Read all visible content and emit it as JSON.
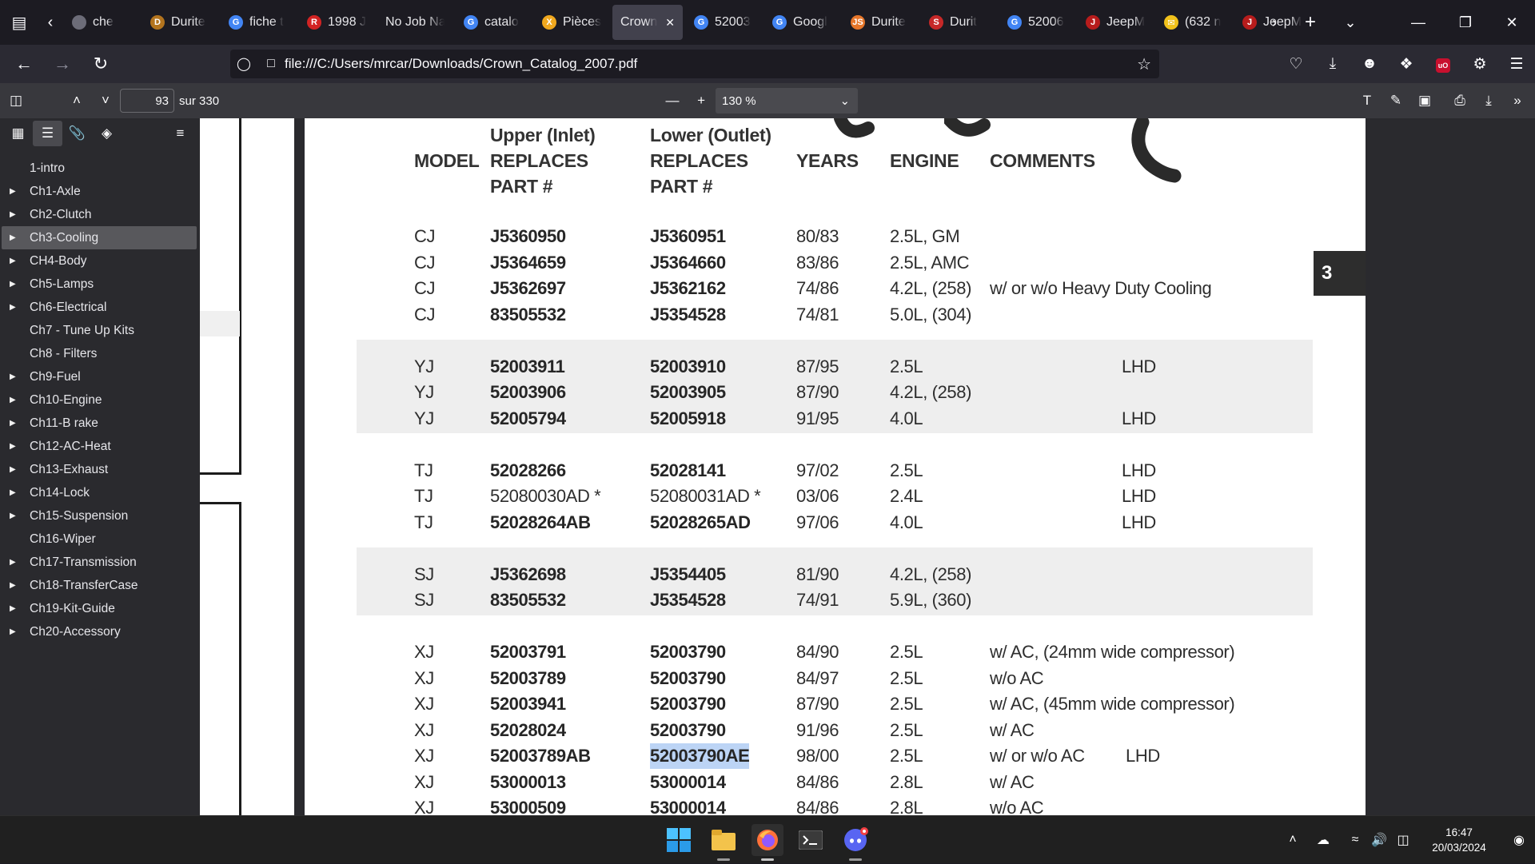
{
  "tabs": [
    {
      "label": "che",
      "icon": "page-icon",
      "color": "#6c6c78"
    },
    {
      "label": "Durite",
      "icon": "site-icon",
      "color": "#b3741e"
    },
    {
      "label": "fiche t",
      "icon": "google-icon",
      "color": "#4285f4"
    },
    {
      "label": "1998 J",
      "icon": "forum-icon",
      "color": "#d22323"
    },
    {
      "label": "No Job Na",
      "icon": "",
      "color": ""
    },
    {
      "label": "catalo",
      "icon": "google-icon",
      "color": "#4285f4"
    },
    {
      "label": "Pièces",
      "icon": "x-shop-icon",
      "color": "#f0a81e"
    },
    {
      "label": "Crown",
      "icon": "",
      "color": "",
      "active": true
    },
    {
      "label": "52003",
      "icon": "google-icon",
      "color": "#4285f4"
    },
    {
      "label": "Googl",
      "icon": "google-lens-icon",
      "color": "#4285f4"
    },
    {
      "label": "Durite",
      "icon": "js-icon",
      "color": "#e6762a"
    },
    {
      "label": "Durit",
      "icon": "shop-icon",
      "color": "#c62828"
    },
    {
      "label": "52006",
      "icon": "google-icon",
      "color": "#4285f4"
    },
    {
      "label": "JeepM",
      "icon": "jeep-icon",
      "color": "#b71c1c"
    },
    {
      "label": "(632 n",
      "icon": "mail-icon",
      "color": "#f2c21b"
    },
    {
      "label": "JeepM",
      "icon": "jeep-icon",
      "color": "#b71c1c"
    }
  ],
  "url": "file:///C:/Users/mrcar/Downloads/Crown_Catalog_2007.pdf",
  "pdf": {
    "page_number": "93",
    "page_count": "sur 330",
    "zoom": "130 %"
  },
  "outline": [
    {
      "label": "1-intro",
      "expandable": false
    },
    {
      "label": "Ch1-Axle",
      "expandable": true
    },
    {
      "label": "Ch2-Clutch",
      "expandable": true
    },
    {
      "label": "Ch3-Cooling",
      "expandable": true,
      "selected": true
    },
    {
      "label": "CH4-Body",
      "expandable": true
    },
    {
      "label": "Ch5-Lamps",
      "expandable": true
    },
    {
      "label": "Ch6-Electrical",
      "expandable": true
    },
    {
      "label": "Ch7 - Tune Up Kits",
      "expandable": false
    },
    {
      "label": "Ch8 - Filters",
      "expandable": false
    },
    {
      "label": "Ch9-Fuel",
      "expandable": true
    },
    {
      "label": "Ch10-Engine",
      "expandable": true
    },
    {
      "label": "Ch11-B rake",
      "expandable": true
    },
    {
      "label": "Ch12-AC-Heat",
      "expandable": true
    },
    {
      "label": "Ch13-Exhaust",
      "expandable": true
    },
    {
      "label": "Ch14-Lock",
      "expandable": true
    },
    {
      "label": "Ch15-Suspension",
      "expandable": true
    },
    {
      "label": "Ch16-Wiper",
      "expandable": false
    },
    {
      "label": "Ch17-Transmission",
      "expandable": true
    },
    {
      "label": "Ch18-TransferCase",
      "expandable": true
    },
    {
      "label": "Ch19-Kit-Guide",
      "expandable": true
    },
    {
      "label": "Ch20-Accessory",
      "expandable": true
    }
  ],
  "catalog": {
    "chapter_tab": "3",
    "headers": {
      "model": "MODEL",
      "upper_1": "Upper (Inlet)",
      "upper_2": "REPLACES",
      "upper_3": "PART #",
      "lower_1": "Lower (Outlet)",
      "lower_2": "REPLACES",
      "lower_3": "PART #",
      "years": "YEARS",
      "engine": "ENGINE",
      "comments": "COMMENTS"
    },
    "groups": [
      {
        "shaded": false,
        "rows": [
          {
            "model": "CJ",
            "upper": "J5360950",
            "lower": "J5360951",
            "years": "80/83",
            "engine": "2.5L, GM",
            "comment": "",
            "note": ""
          },
          {
            "model": "CJ",
            "upper": "J5364659",
            "lower": "J5364660",
            "years": "83/86",
            "engine": "2.5L, AMC",
            "comment": "",
            "note": ""
          },
          {
            "model": "CJ",
            "upper": "J5362697",
            "lower": "J5362162",
            "years": "74/86",
            "engine": "4.2L, (258)",
            "comment": "w/ or w/o Heavy Duty Cooling",
            "note": ""
          },
          {
            "model": "CJ",
            "upper": "83505532",
            "lower": "J5354528",
            "years": "74/81",
            "engine": "5.0L, (304)",
            "comment": "",
            "note": ""
          }
        ]
      },
      {
        "shaded": true,
        "rows": [
          {
            "model": "YJ",
            "upper": "52003911",
            "lower": "52003910",
            "years": "87/95",
            "engine": "2.5L",
            "comment": "",
            "note": "LHD"
          },
          {
            "model": "YJ",
            "upper": "52003906",
            "lower": "52003905",
            "years": "87/90",
            "engine": "4.2L, (258)",
            "comment": "",
            "note": ""
          },
          {
            "model": "YJ",
            "upper": "52005794",
            "lower": "52005918",
            "years": "91/95",
            "engine": "4.0L",
            "comment": "",
            "note": "LHD"
          }
        ]
      },
      {
        "shaded": false,
        "rows": [
          {
            "model": "TJ",
            "upper": "52028266",
            "lower": "52028141",
            "years": "97/02",
            "engine": "2.5L",
            "comment": "",
            "note": "LHD"
          },
          {
            "model": "TJ",
            "upper": "52080030AD *",
            "lower": "52080031AD *",
            "years": "03/06",
            "engine": "2.4L",
            "comment": "",
            "note": "LHD",
            "regular": true
          },
          {
            "model": "TJ",
            "upper": "52028264AB",
            "lower": "52028265AD",
            "years": "97/06",
            "engine": "4.0L",
            "comment": "",
            "note": "LHD"
          }
        ]
      },
      {
        "shaded": true,
        "rows": [
          {
            "model": "SJ",
            "upper": "J5362698",
            "lower": "J5354405",
            "years": "81/90",
            "engine": "4.2L, (258)",
            "comment": "",
            "note": ""
          },
          {
            "model": "SJ",
            "upper": "83505532",
            "lower": "J5354528",
            "years": "74/91",
            "engine": "5.9L, (360)",
            "comment": "",
            "note": ""
          }
        ]
      },
      {
        "shaded": false,
        "rows": [
          {
            "model": "XJ",
            "upper": "52003791",
            "lower": "52003790",
            "years": "84/90",
            "engine": "2.5L",
            "comment": "w/ AC,  (24mm wide compressor)",
            "note": ""
          },
          {
            "model": "XJ",
            "upper": "52003789",
            "lower": "52003790",
            "years": "84/97",
            "engine": "2.5L",
            "comment": "w/o AC",
            "note": ""
          },
          {
            "model": "XJ",
            "upper": "52003941",
            "lower": "52003790",
            "years": "87/90",
            "engine": "2.5L",
            "comment": "w/ AC, (45mm wide compressor)",
            "note": ""
          },
          {
            "model": "XJ",
            "upper": "52028024",
            "lower": "52003790",
            "years": "91/96",
            "engine": "2.5L",
            "comment": "w/ AC",
            "note": ""
          },
          {
            "model": "XJ",
            "upper": "52003789AB",
            "lower": "52003790AE",
            "years": "98/00",
            "engine": "2.5L",
            "comment": "w/ or w/o AC",
            "note": "LHD",
            "highlight_lower": true
          },
          {
            "model": "XJ",
            "upper": "53000013",
            "lower": "53000014",
            "years": "84/86",
            "engine": "2.8L",
            "comment": "w/ AC",
            "note": ""
          },
          {
            "model": "XJ",
            "upper": "53000509",
            "lower": "53000014",
            "years": "84/86",
            "engine": "2.8L",
            "comment": "w/o AC",
            "note": ""
          }
        ]
      }
    ]
  },
  "taskbar": {
    "apps": [
      "start-icon",
      "file-explorer-icon",
      "firefox-icon",
      "terminal-icon",
      "discord-icon"
    ],
    "time": "16:47",
    "date": "20/03/2024"
  }
}
